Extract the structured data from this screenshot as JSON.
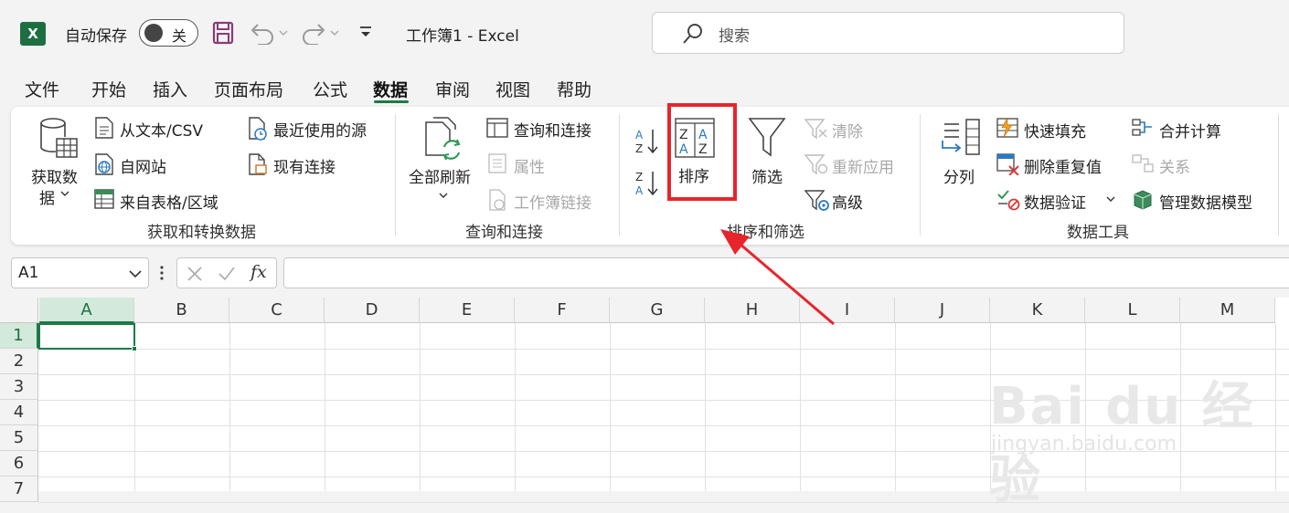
{
  "app": {
    "logo_letter": "X",
    "autosave_label": "自动保存",
    "autosave_state": "关",
    "document_title": "工作簿1  -  Excel",
    "search_placeholder": "搜索"
  },
  "tabs": [
    {
      "label": "文件"
    },
    {
      "label": "开始"
    },
    {
      "label": "插入"
    },
    {
      "label": "页面布局"
    },
    {
      "label": "公式"
    },
    {
      "label": "数据",
      "active": true
    },
    {
      "label": "审阅"
    },
    {
      "label": "视图"
    },
    {
      "label": "帮助"
    }
  ],
  "ribbon": {
    "get_data": {
      "big_button": [
        "获取数",
        "据"
      ],
      "from_text_csv": "从文本/CSV",
      "from_web": "自网站",
      "from_table": "来自表格/区域",
      "recent_sources": "最近使用的源",
      "existing_connections": "现有连接",
      "group_label": "获取和转换数据"
    },
    "queries": {
      "refresh_all": "全部刷新",
      "queries_connections": "查询和连接",
      "properties": "属性",
      "workbook_links": "工作簿链接",
      "group_label": "查询和连接"
    },
    "sort_filter": {
      "sort": "排序",
      "filter": "筛选",
      "clear": "清除",
      "reapply": "重新应用",
      "advanced": "高级",
      "group_label": "排序和筛选"
    },
    "data_tools": {
      "text_to_columns": "分列",
      "flash_fill": "快速填充",
      "remove_duplicates": "删除重复值",
      "data_validation": "数据验证",
      "consolidate": "合并计算",
      "relationships": "关系",
      "manage_data_model": "管理数据模型",
      "group_label": "数据工具"
    }
  },
  "formula_bar": {
    "name_box": "A1",
    "fx": "fx",
    "formula": ""
  },
  "columns": [
    "A",
    "B",
    "C",
    "D",
    "E",
    "F",
    "G",
    "H",
    "I",
    "J",
    "K",
    "L",
    "M"
  ],
  "rows": [
    "1",
    "2",
    "3",
    "4",
    "5",
    "6",
    "7"
  ],
  "selected_cell": "A1",
  "watermark": {
    "main": "Bai du 经验",
    "sub": "jingyan.baidu.com"
  },
  "colors": {
    "accent": "#1d7a45",
    "highlight": "#e8242b",
    "excel_green": "#1d6f42"
  }
}
